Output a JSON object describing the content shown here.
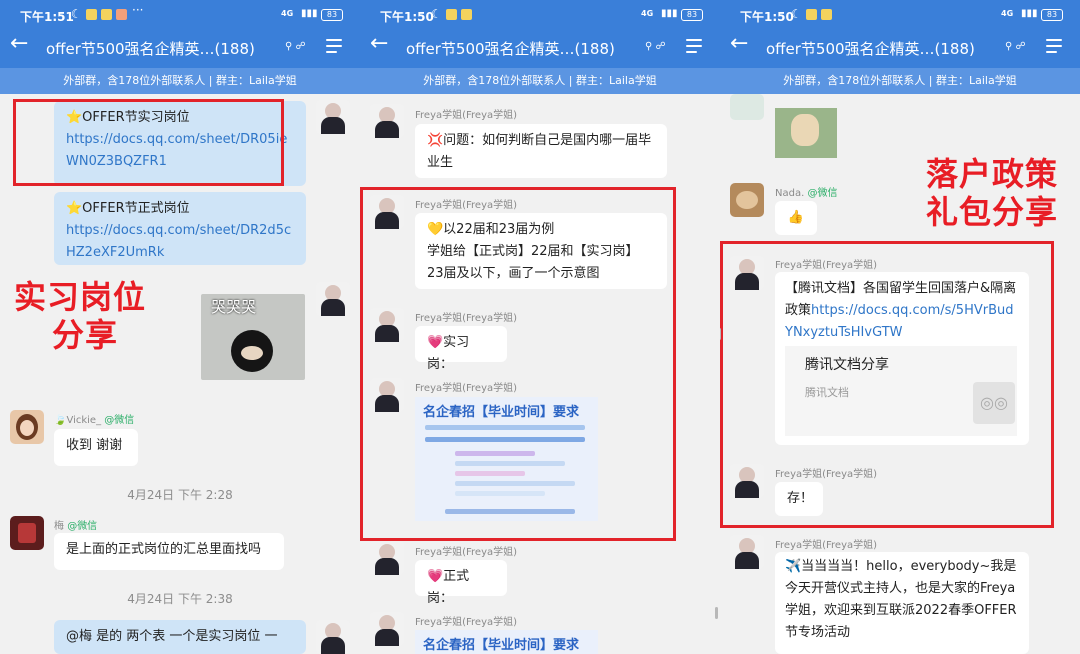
{
  "status": {
    "time1": "下午1:51",
    "time2": "下午1:50",
    "time3": "下午1:50",
    "signal": "4G",
    "battery": "83"
  },
  "header": {
    "back_icon": "arrow-left-icon",
    "title": "offer节500强名企精英…(188)",
    "menu_icon": "menu-icon",
    "subtitle": "外部群，含178位外部联系人 | 群主：Laila学姐"
  },
  "colors": {
    "header": "#3a7fd9",
    "highlight": "#e2232a",
    "link": "#2f76c8",
    "wechat": "#2aae67"
  },
  "p1": {
    "msg1_title": "⭐OFFER节实习岗位",
    "msg1_link": "https://docs.qq.com/sheet/DR05ieWN0Z3BQZFR1",
    "msg2_title": "⭐OFFER节正式岗位",
    "msg2_link": "https://docs.qq.com/sheet/DR2d5cHZ2eXF2UmRk",
    "promo_line1": "实习岗位",
    "promo_line2": "分享",
    "sticker_text": "哭哭哭",
    "vickie_name": "Vickie_",
    "wechat_tag": "@微信",
    "vickie_msg": "收到 谢谢",
    "time1": "4月24日 下午 2:28",
    "mei_name": "梅",
    "mei_msg": "是上面的正式岗位的汇总里面找吗",
    "time2": "4月24日 下午 2:38",
    "last_msg": "@梅 是的 两个表 一个是实习岗位 一"
  },
  "p2": {
    "freya": "Freya学姐(Freya学姐)",
    "q_msg": "💢问题：如何判断自己是国内哪一届毕业生",
    "a_msg1": "💛以22届和23届为例",
    "a_msg2": "学姐给【正式岗】22届和【实习岗】23届及以下，画了一个示意图",
    "intern_label": "💗实习岗：",
    "fulltime_label": "💗正式岗：",
    "thumb_title": "名企春招【毕业时间】要求"
  },
  "p3": {
    "nada_name": "Nada.",
    "wechat_tag": "@微信",
    "thumb_emoji": "👍",
    "promo_line1": "落户政策",
    "promo_line2": "礼包分享",
    "freya": "Freya学姐(Freya学姐)",
    "doc_prefix": "【腾讯文档】各国留学生回国落户&隔离政策",
    "doc_link": "https://docs.qq.com/s/5HVrBudYNxyztuTsHIvGTW",
    "card_title": "腾讯文档分享",
    "card_sub": "腾讯文档",
    "cun_msg": "存！",
    "last_msg": "✈️当当当当！hello，everybody~我是今天开营仪式主持人，也是大家的Freya学姐，欢迎来到互联派2022春季OFFER节专场活动"
  }
}
